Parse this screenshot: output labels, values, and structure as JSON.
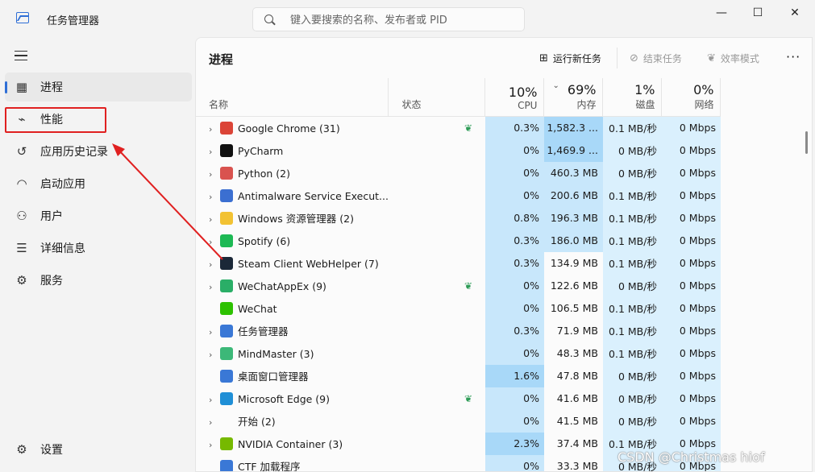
{
  "window": {
    "title": "任务管理器",
    "minimize": "—",
    "maximize": "☐",
    "close": "✕"
  },
  "search": {
    "placeholder": "键入要搜索的名称、发布者或 PID"
  },
  "sidebar": {
    "items": [
      {
        "label": "进程",
        "icon": "processes-icon",
        "active": true
      },
      {
        "label": "性能",
        "icon": "performance-icon",
        "active": false
      },
      {
        "label": "应用历史记录",
        "icon": "history-icon",
        "active": false
      },
      {
        "label": "启动应用",
        "icon": "startup-icon",
        "active": false
      },
      {
        "label": "用户",
        "icon": "users-icon",
        "active": false
      },
      {
        "label": "详细信息",
        "icon": "details-icon",
        "active": false
      },
      {
        "label": "服务",
        "icon": "services-icon",
        "active": false
      }
    ],
    "settings_label": "设置"
  },
  "toolbar": {
    "page_title": "进程",
    "run_new_task": "运行新任务",
    "end_task": "结束任务",
    "efficiency_mode": "效率模式"
  },
  "table": {
    "columns": {
      "name": "名称",
      "status": "状态",
      "cpu": "CPU",
      "memory": "内存",
      "disk": "磁盘",
      "network": "网络"
    },
    "totals": {
      "cpu": "10%",
      "memory": "69%",
      "disk": "1%",
      "network": "0%"
    },
    "rows": [
      {
        "name": "Google Chrome (31)",
        "expandable": true,
        "eco": true,
        "cpu": "0.3%",
        "mem": "1,582.3 ...",
        "disk": "0.1 MB/秒",
        "net": "0 Mbps",
        "icon_color": "#db4437",
        "mem_hl": 2,
        "cpu_hl": 1
      },
      {
        "name": "PyCharm",
        "expandable": true,
        "eco": false,
        "cpu": "0%",
        "mem": "1,469.9 ...",
        "disk": "0 MB/秒",
        "net": "0 Mbps",
        "icon_color": "#111111",
        "mem_hl": 2,
        "cpu_hl": 1
      },
      {
        "name": "Python (2)",
        "expandable": true,
        "eco": false,
        "cpu": "0%",
        "mem": "460.3 MB",
        "disk": "0 MB/秒",
        "net": "0 Mbps",
        "icon_color": "#d9534f",
        "mem_hl": 1,
        "cpu_hl": 1
      },
      {
        "name": "Antimalware Service Execut...",
        "expandable": true,
        "eco": false,
        "cpu": "0%",
        "mem": "200.6 MB",
        "disk": "0.1 MB/秒",
        "net": "0 Mbps",
        "icon_color": "#3b6fd1",
        "mem_hl": 1,
        "cpu_hl": 1
      },
      {
        "name": "Windows 资源管理器 (2)",
        "expandable": true,
        "eco": false,
        "cpu": "0.8%",
        "mem": "196.3 MB",
        "disk": "0.1 MB/秒",
        "net": "0 Mbps",
        "icon_color": "#f2c233",
        "mem_hl": 1,
        "cpu_hl": 1
      },
      {
        "name": "Spotify (6)",
        "expandable": true,
        "eco": false,
        "cpu": "0.3%",
        "mem": "186.0 MB",
        "disk": "0.1 MB/秒",
        "net": "0 Mbps",
        "icon_color": "#1db954",
        "mem_hl": 1,
        "cpu_hl": 1
      },
      {
        "name": "Steam Client WebHelper (7)",
        "expandable": true,
        "eco": false,
        "cpu": "0.3%",
        "mem": "134.9 MB",
        "disk": "0.1 MB/秒",
        "net": "0 Mbps",
        "icon_color": "#1b2838",
        "mem_hl": 0,
        "cpu_hl": 1
      },
      {
        "name": "WeChatAppEx (9)",
        "expandable": true,
        "eco": true,
        "cpu": "0%",
        "mem": "122.6 MB",
        "disk": "0 MB/秒",
        "net": "0 Mbps",
        "icon_color": "#2aae67",
        "mem_hl": 0,
        "cpu_hl": 1
      },
      {
        "name": "WeChat",
        "expandable": false,
        "eco": false,
        "cpu": "0%",
        "mem": "106.5 MB",
        "disk": "0.1 MB/秒",
        "net": "0 Mbps",
        "icon_color": "#2dc100",
        "mem_hl": 0,
        "cpu_hl": 1
      },
      {
        "name": "任务管理器",
        "expandable": true,
        "eco": false,
        "cpu": "0.3%",
        "mem": "71.9 MB",
        "disk": "0.1 MB/秒",
        "net": "0 Mbps",
        "icon_color": "#3a78d6",
        "mem_hl": 0,
        "cpu_hl": 1
      },
      {
        "name": "MindMaster (3)",
        "expandable": true,
        "eco": false,
        "cpu": "0%",
        "mem": "48.3 MB",
        "disk": "0.1 MB/秒",
        "net": "0 Mbps",
        "icon_color": "#3cb878",
        "mem_hl": 0,
        "cpu_hl": 1
      },
      {
        "name": "桌面窗口管理器",
        "expandable": false,
        "eco": false,
        "cpu": "1.6%",
        "mem": "47.8 MB",
        "disk": "0 MB/秒",
        "net": "0 Mbps",
        "icon_color": "#3a78d6",
        "mem_hl": 0,
        "cpu_hl": 2
      },
      {
        "name": "Microsoft Edge (9)",
        "expandable": true,
        "eco": true,
        "cpu": "0%",
        "mem": "41.6 MB",
        "disk": "0 MB/秒",
        "net": "0 Mbps",
        "icon_color": "#1f8fd6",
        "mem_hl": 0,
        "cpu_hl": 1
      },
      {
        "name": "开始 (2)",
        "expandable": true,
        "eco": false,
        "cpu": "0%",
        "mem": "41.5 MB",
        "disk": "0 MB/秒",
        "net": "0 Mbps",
        "icon_color": "#fbfbfb",
        "mem_hl": 0,
        "cpu_hl": 1
      },
      {
        "name": "NVIDIA Container (3)",
        "expandable": true,
        "eco": false,
        "cpu": "2.3%",
        "mem": "37.4 MB",
        "disk": "0.1 MB/秒",
        "net": "0 Mbps",
        "icon_color": "#76b900",
        "mem_hl": 0,
        "cpu_hl": 2
      },
      {
        "name": "CTF 加载程序",
        "expandable": false,
        "eco": false,
        "cpu": "0%",
        "mem": "33.3 MB",
        "disk": "0 MB/秒",
        "net": "0 Mbps",
        "icon_color": "#3a78d6",
        "mem_hl": 0,
        "cpu_hl": 1
      }
    ]
  },
  "watermark": "CSDN @Christmas hiof"
}
